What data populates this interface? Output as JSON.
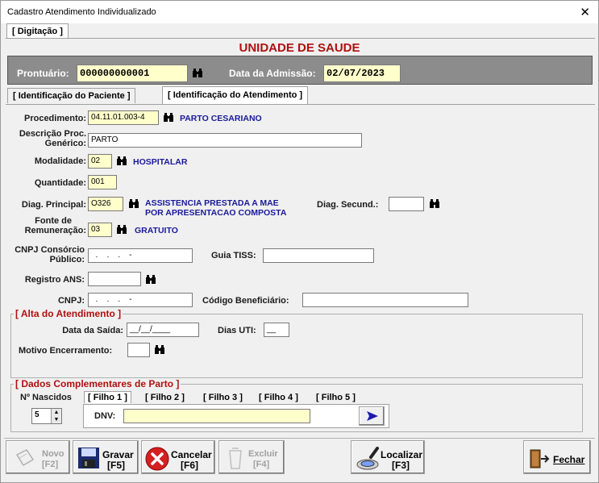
{
  "window": {
    "title": "Cadastro Atendimento Individualizado",
    "close": "✕"
  },
  "top_tab": "[ Digitação ]",
  "unit_title": "UNIDADE DE SAUDE",
  "header": {
    "prontuario_label": "Prontuário:",
    "prontuario_value": "000000000001",
    "admissao_label": "Data da Admissão:",
    "admissao_value": "02/07/2023"
  },
  "tabs": [
    "[ Identificação do Paciente ]",
    "[ Identificação do Atendimento  ]"
  ],
  "form": {
    "procedimento_label": "Procedimento:",
    "procedimento_value": "04.11.01.003-4",
    "procedimento_desc": "PARTO CESARIANO",
    "descricao_label_1": "Descrição Proc.",
    "descricao_label_2": "Genérico:",
    "descricao_value": "PARTO",
    "modalidade_label": "Modalidade:",
    "modalidade_value": "02",
    "modalidade_desc": "HOSPITALAR",
    "quantidade_label": "Quantidade:",
    "quantidade_value": "001",
    "diag_principal_label": "Diag. Principal:",
    "diag_principal_value": "O326",
    "diag_principal_desc_1": "ASSISTENCIA PRESTADA A MAE",
    "diag_principal_desc_2": "POR APRESENTACAO COMPOSTA",
    "diag_secund_label": "Diag. Secund.:",
    "diag_secund_value": "",
    "fonte_label_1": "Fonte de",
    "fonte_label_2": "Remuneração:",
    "fonte_value": "03",
    "fonte_desc": "GRATUITO",
    "cnpj_consorcio_label_1": "CNPJ Consórcio",
    "cnpj_consorcio_label_2": "Público:",
    "cnpj_consorcio_value": "  .    .    .    -",
    "guia_tiss_label": "Guia TISS:",
    "guia_tiss_value": "",
    "registro_ans_label": "Registro ANS:",
    "registro_ans_value": "",
    "cnpj_label": "CNPJ:",
    "cnpj_value": "  .    .    .    -",
    "codigo_benef_label": "Código Beneficiário:",
    "codigo_benef_value": ""
  },
  "alta": {
    "title": "[ Alta do Atendimento ]",
    "data_saida_label": "Data da Saída:",
    "data_saida_value": "__/__/____",
    "dias_uti_label": "Dias UTI:",
    "dias_uti_value": "__",
    "motivo_label": "Motivo Encerramento:",
    "motivo_value": ""
  },
  "parto": {
    "title": "[ Dados Complementares de Parto ]",
    "nascidos_label": "Nº Nascidos",
    "nascidos_value": "5",
    "filhos": [
      "[ Filho 1 ]",
      "[ Filho 2 ]",
      "[ Filho 3 ]",
      "[ Filho 4 ]",
      "[ Filho 5 ]"
    ],
    "dnv_label": "DNV:",
    "dnv_value": ""
  },
  "toolbar": {
    "novo": [
      "Novo",
      "[F2]"
    ],
    "gravar": [
      "Gravar",
      "[F5]"
    ],
    "cancelar": [
      "Cancelar",
      "[F6]"
    ],
    "excluir": [
      "Excluir",
      "[F4]"
    ],
    "localizar": [
      "Localizar",
      "[F3]"
    ],
    "fechar": "Fechar"
  },
  "colors": {
    "title_red": "#b01010",
    "blue_text": "#1a1a99",
    "yellow_input": "#ffffcc",
    "header_gray": "#8c8c8c"
  }
}
